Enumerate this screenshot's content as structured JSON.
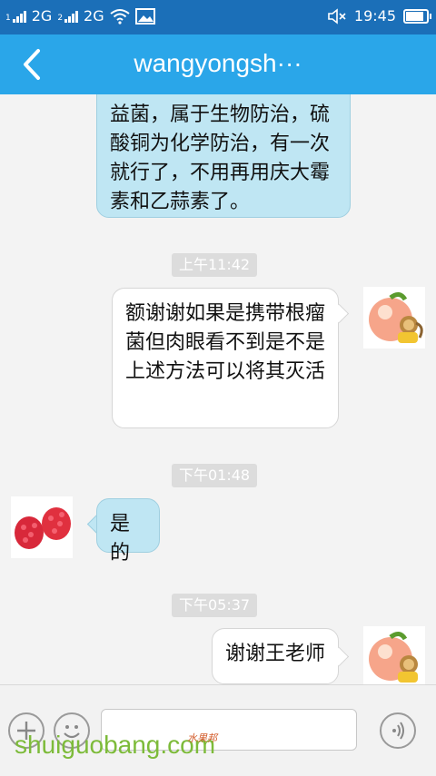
{
  "status": {
    "sim1": "1",
    "network1": "2G",
    "sim2": "2",
    "network2": "2G",
    "time": "19:45",
    "battery_fraction": 0.85
  },
  "header": {
    "title": "wangyongsh···"
  },
  "messages": [
    {
      "side": "in",
      "text": "益菌，属于生物防治，硫酸铜为化学防治，有一次就行了，不用再用庆大霉素和乙蒜素了。"
    },
    {
      "time": "上午11:42"
    },
    {
      "side": "out",
      "text": "额谢谢如果是携带根瘤菌但肉眼看不到是不是上述方法可以将其灭活"
    },
    {
      "time": "下午01:48"
    },
    {
      "side": "in",
      "text": "是的"
    },
    {
      "time": "下午05:37"
    },
    {
      "side": "out",
      "text": "谢谢王老师"
    }
  ],
  "watermark": {
    "text": "shuiguobang.com",
    "cn": "水果邦"
  }
}
